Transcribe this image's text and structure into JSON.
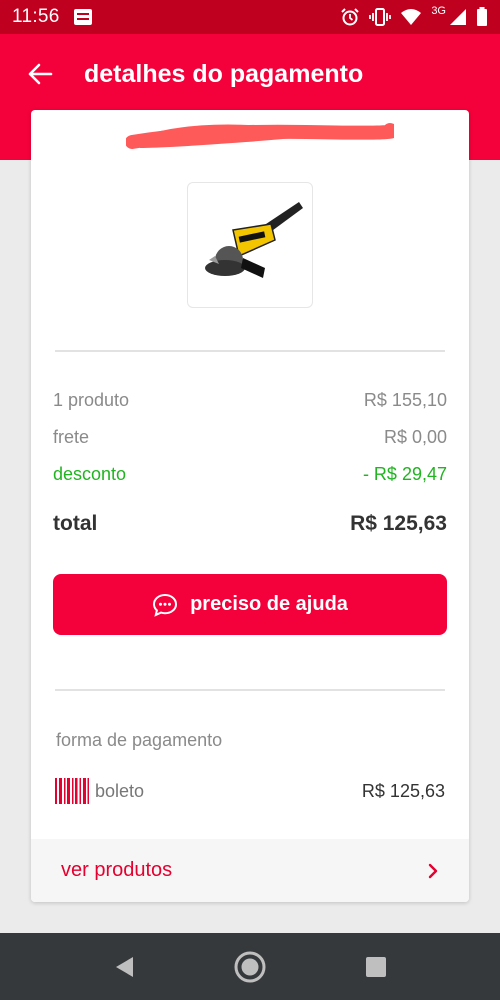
{
  "status_bar": {
    "time": "11:56",
    "network": "3G"
  },
  "header": {
    "title": "detalhes do pagamento"
  },
  "summary": {
    "products_label": "1 produto",
    "products_value": "R$ 155,10",
    "shipping_label": "frete",
    "shipping_value": "R$ 0,00",
    "discount_label": "desconto",
    "discount_value": "- R$ 29,47",
    "total_label": "total",
    "total_value": "R$ 125,63"
  },
  "help_button": {
    "label": "preciso de ajuda"
  },
  "payment": {
    "title": "forma de pagamento",
    "method": "boleto",
    "amount": "R$ 125,63"
  },
  "see_products": {
    "label": "ver produtos"
  },
  "colors": {
    "primary": "#f4003a",
    "status_bar": "#c0001f",
    "discount": "#21b421",
    "nav_bar": "#36393c"
  },
  "icons": [
    "arrow-left-icon",
    "chat-bubble-icon",
    "barcode-icon",
    "chevron-right-icon",
    "alarm-icon",
    "vibrate-icon",
    "wifi-icon",
    "signal-icon",
    "battery-icon"
  ]
}
